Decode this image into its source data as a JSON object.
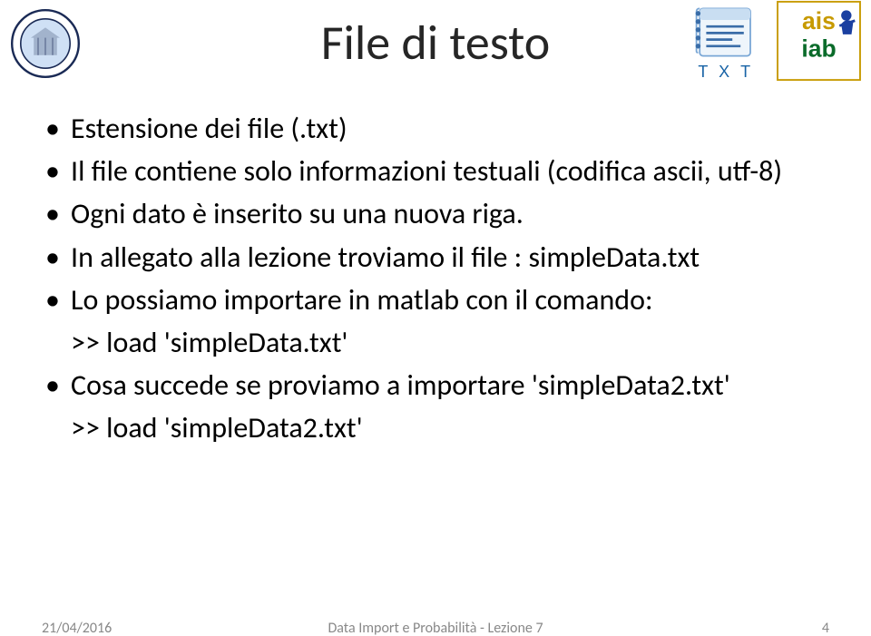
{
  "title": "File di testo",
  "bullets": {
    "b1": "Estensione dei file (.txt)",
    "b2": "Il file contiene solo informazioni testuali (codifica ascii, utf-8)",
    "b3": "Ogni dato è inserito su una nuova riga.",
    "b4": "In allegato alla lezione troviamo il file : simpleData.txt",
    "b5": "Lo possiamo importare in matlab con il comando:",
    "cmd1": ">> load 'simpleData.txt'",
    "b6": "Cosa succede se proviamo a importare 'simpleData2.txt'",
    "cmd2": ">> load 'simpleData2.txt'"
  },
  "footer": {
    "date": "21/04/2016",
    "lesson": "Data Import e Probabilità - Lezione 7",
    "page": "4"
  },
  "icons": {
    "txt_label": "T X T",
    "right_logo_top": "ais",
    "right_logo_bottom": "iab"
  }
}
